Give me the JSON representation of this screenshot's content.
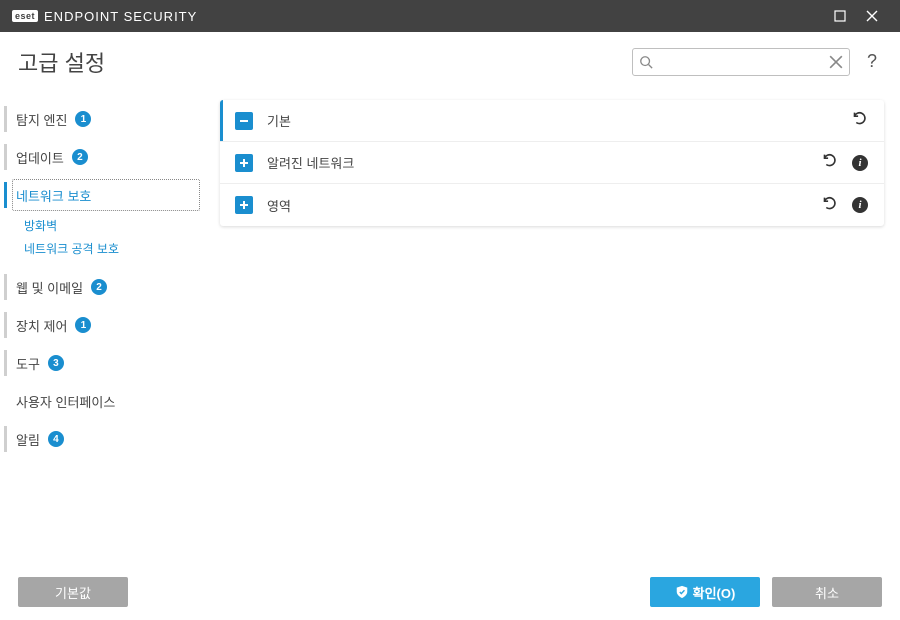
{
  "title_bar": {
    "logo": "eset",
    "product": "ENDPOINT SECURITY"
  },
  "header": {
    "page_title": "고급 설정",
    "search_placeholder": ""
  },
  "sidebar": {
    "items": [
      {
        "label": "탐지 엔진",
        "badge": "1"
      },
      {
        "label": "업데이트",
        "badge": "2"
      },
      {
        "label": "네트워크 보호",
        "sub": [
          {
            "label": "방화벽"
          },
          {
            "label": "네트워크 공격 보호"
          }
        ]
      },
      {
        "label": "웹 및 이메일",
        "badge": "2"
      },
      {
        "label": "장치 제어",
        "badge": "1"
      },
      {
        "label": "도구",
        "badge": "3"
      },
      {
        "label": "사용자 인터페이스"
      },
      {
        "label": "알림",
        "badge": "4"
      }
    ]
  },
  "content": {
    "sections": [
      {
        "label": "기본",
        "expanded": true,
        "show_info": false
      },
      {
        "label": "알려진 네트워크",
        "expanded": false,
        "show_info": true
      },
      {
        "label": "영역",
        "expanded": false,
        "show_info": true
      }
    ]
  },
  "footer": {
    "default_btn": "기본값",
    "ok_btn": "확인(O)",
    "cancel_btn": "취소"
  }
}
